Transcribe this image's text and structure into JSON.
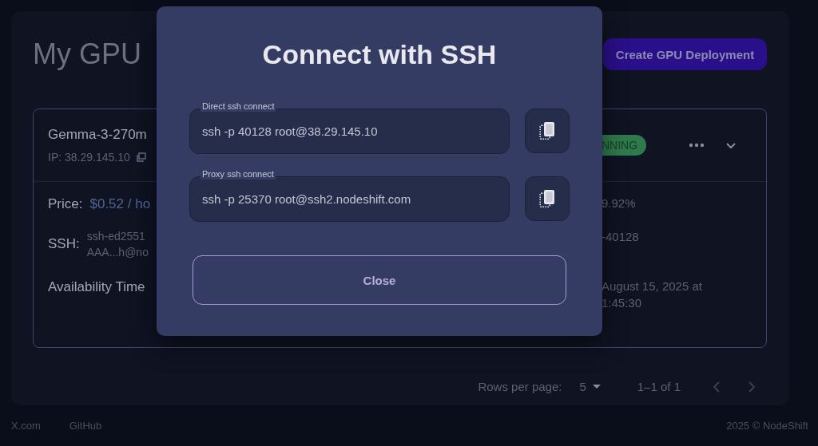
{
  "page": {
    "title": "My GPU",
    "create_button": "Create GPU Deployment"
  },
  "deployment": {
    "name": "Gemma-3-270m",
    "ip": "IP: 38.29.145.10",
    "status": "NNING",
    "details": [
      {
        "kind": "price",
        "label": "Price:",
        "lines": [
          "$0.52 / ho"
        ],
        "right_lines": [
          "9.92%"
        ]
      },
      {
        "kind": "ssh",
        "label": "SSH:",
        "lines": [
          "ssh-ed2551",
          "AAA...h@no"
        ],
        "right_lines": [
          "-40128"
        ]
      },
      {
        "kind": "availability",
        "label": "Availability Time",
        "right_lines": [
          "August 15, 2025 at",
          "1:45:30"
        ]
      }
    ]
  },
  "pagination": {
    "label": "Rows per page:",
    "rows": "5",
    "range": "1–1 of 1"
  },
  "footer": {
    "links": [
      "X.com",
      "GitHub"
    ],
    "copyright": "2025 © NodeShift"
  },
  "modal": {
    "title": "Connect with SSH",
    "fields": [
      {
        "label": "Direct ssh connect",
        "value": "ssh -p 40128 root@38.29.145.10"
      },
      {
        "label": "Proxy ssh connect",
        "value": "ssh -p 25370 root@ssh2.nodeshift.com"
      }
    ],
    "close": "Close"
  }
}
